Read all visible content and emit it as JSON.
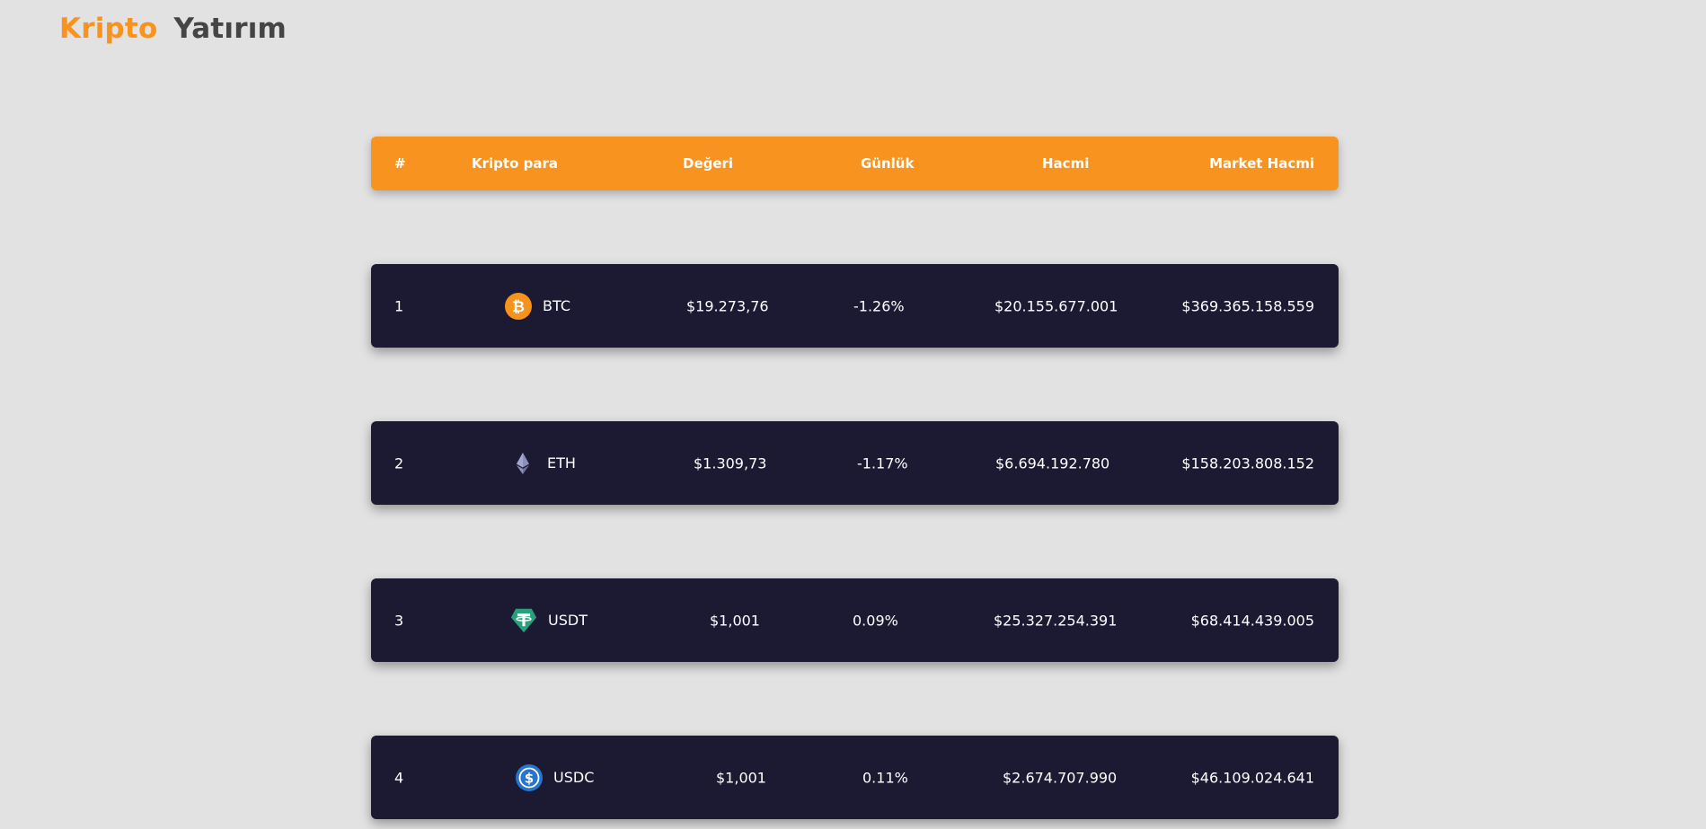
{
  "brand": {
    "part1": "Kripto",
    "part2": "Yatırım"
  },
  "table": {
    "headers": {
      "rank": "#",
      "name": "Kripto para",
      "value": "Değeri",
      "daily": "Günlük",
      "volume": "Hacmi",
      "market": "Market Hacmi"
    },
    "rows": [
      {
        "rank": "1",
        "symbol": "BTC",
        "icon": "bitcoin-icon",
        "value": "$19.273,76",
        "daily": "-1.26%",
        "volume": "$20.155.677.001",
        "market": "$369.365.158.559"
      },
      {
        "rank": "2",
        "symbol": "ETH",
        "icon": "ethereum-icon",
        "value": "$1.309,73",
        "daily": "-1.17%",
        "volume": "$6.694.192.780",
        "market": "$158.203.808.152"
      },
      {
        "rank": "3",
        "symbol": "USDT",
        "icon": "tether-icon",
        "value": "$1,001",
        "daily": "0.09%",
        "volume": "$25.327.254.391",
        "market": "$68.414.439.005"
      },
      {
        "rank": "4",
        "symbol": "USDC",
        "icon": "usd-coin-icon",
        "value": "$1,001",
        "daily": "0.11%",
        "volume": "$2.674.707.990",
        "market": "$46.109.024.641"
      }
    ]
  },
  "colors": {
    "accent": "#f7931e",
    "row_background": "#1c1933",
    "page_background": "#e2e2e2",
    "brand_dark": "#454545"
  }
}
